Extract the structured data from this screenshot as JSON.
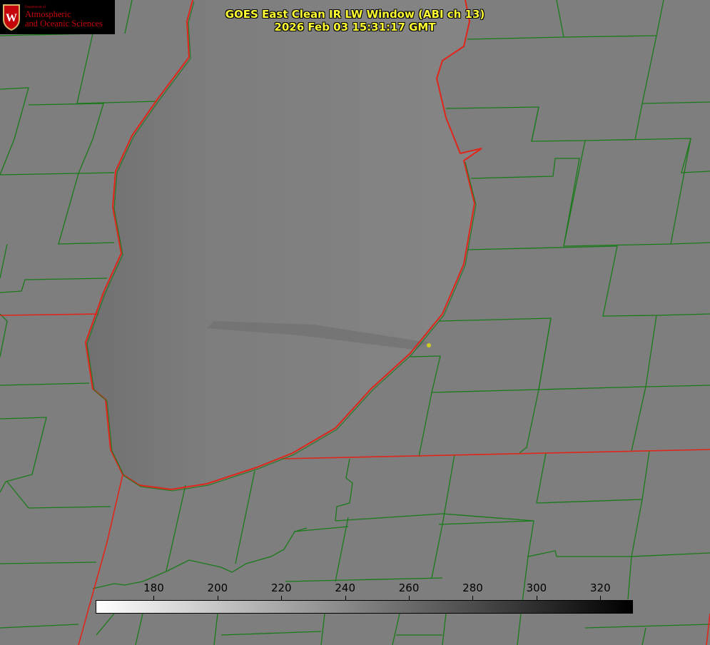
{
  "title": {
    "line1": "GOES East Clean IR LW Window (ABI ch 13)",
    "line2": "2026 Feb 03 15:31:17 GMT"
  },
  "logo": {
    "dept": "Department of",
    "line1": "Atmospheric",
    "line2": "and Oceanic Sciences",
    "mark": "W"
  },
  "colorbar": {
    "min": 162,
    "max": 330,
    "ticks": [
      "180",
      "200",
      "220",
      "240",
      "260",
      "280",
      "300",
      "320"
    ],
    "tick_values": [
      180,
      200,
      220,
      240,
      260,
      280,
      300,
      320
    ],
    "colormap": "white-to-black"
  },
  "colors": {
    "title": "#ffff33",
    "county_lines": "#1a7a1a",
    "state_lines": "#e0251a",
    "marker": "#cccc22"
  }
}
